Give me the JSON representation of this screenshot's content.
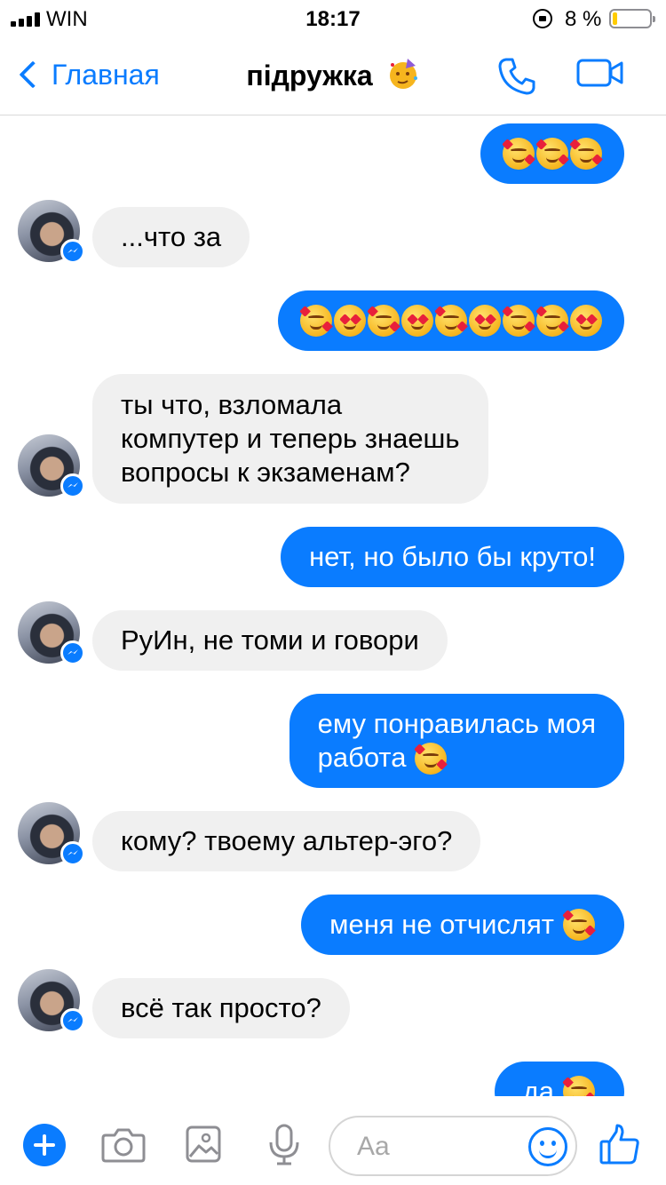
{
  "status_bar": {
    "carrier": "WIN",
    "time": "18:17",
    "battery_percent": "8 %",
    "battery_level": 0.08,
    "signal_bars": 4
  },
  "header": {
    "back_label": "Главная",
    "title": "підружка",
    "title_emoji": "partying-face",
    "accent_color": "#0a7cff"
  },
  "messages": [
    {
      "dir": "out",
      "text": "",
      "emojis": [
        "smiling-hearts",
        "smiling-hearts",
        "smiling-hearts"
      ]
    },
    {
      "dir": "in",
      "text": "...что за"
    },
    {
      "dir": "out",
      "text": "",
      "emojis": [
        "smiling-hearts",
        "heart-eyes",
        "smiling-hearts",
        "heart-eyes",
        "smiling-hearts",
        "heart-eyes",
        "smiling-hearts",
        "smiling-hearts",
        "heart-eyes"
      ]
    },
    {
      "dir": "in",
      "lines": [
        "ты что, взломала",
        "компутер и теперь знаешь",
        "вопросы к экзаменам?"
      ]
    },
    {
      "dir": "out",
      "text": "нет, но было бы круто!"
    },
    {
      "dir": "in",
      "text": "РуИн, не томи и говори"
    },
    {
      "dir": "out",
      "lines": [
        "ему понравилась моя",
        "работа"
      ],
      "emojis": [
        "smiling-hearts"
      ]
    },
    {
      "dir": "in",
      "text": "кому? твоему альтер-эго?"
    },
    {
      "dir": "out",
      "text": "меня не отчислят",
      "emojis": [
        "smiling-hearts"
      ]
    },
    {
      "dir": "in",
      "text": "всё так просто?"
    },
    {
      "dir": "out",
      "text": "да",
      "emojis": [
        "smiling-hearts"
      ]
    }
  ],
  "composer": {
    "placeholder": "Aa",
    "icons": [
      "plus-icon",
      "camera-icon",
      "gallery-icon",
      "microphone-icon",
      "emoji-icon",
      "thumbs-up-icon"
    ]
  }
}
